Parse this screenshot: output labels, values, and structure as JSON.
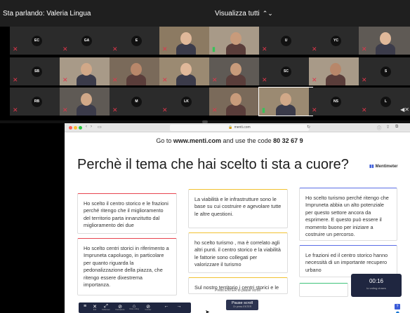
{
  "conference": {
    "speaking_label": "Sta parlando: Valeria Lingua",
    "view_all_label": "Visualizza tutti"
  },
  "participants": [
    {
      "initials": "EC",
      "mic": "muted"
    },
    {
      "initials": "GA",
      "mic": "muted"
    },
    {
      "initials": "E",
      "mic": "muted"
    },
    {
      "initials": "",
      "mic": "muted",
      "video": true
    },
    {
      "initials": "",
      "mic": "on",
      "video": true
    },
    {
      "initials": "U",
      "mic": "muted"
    },
    {
      "initials": "YC",
      "mic": "muted"
    },
    {
      "initials": "",
      "mic": "muted",
      "video": true
    },
    {
      "initials": "SB",
      "mic": "muted"
    },
    {
      "initials": "",
      "mic": "muted",
      "video": true
    },
    {
      "initials": "",
      "mic": "muted",
      "video": true
    },
    {
      "initials": "",
      "mic": "muted",
      "video": true
    },
    {
      "initials": "",
      "mic": "muted",
      "video": true
    },
    {
      "initials": "SC",
      "mic": "muted"
    },
    {
      "initials": "",
      "mic": "muted",
      "video": true
    },
    {
      "initials": "S",
      "mic": "muted"
    },
    {
      "initials": "RB",
      "mic": "muted"
    },
    {
      "initials": "",
      "mic": "muted",
      "video": true
    },
    {
      "initials": "M",
      "mic": "muted"
    },
    {
      "initials": "LK",
      "mic": "muted"
    },
    {
      "initials": "",
      "mic": "muted",
      "video": true
    },
    {
      "initials": "",
      "mic": "on",
      "video": true
    },
    {
      "initials": "NS",
      "mic": "muted"
    },
    {
      "initials": "L",
      "mic": "muted"
    }
  ],
  "browser": {
    "url": "menti.com"
  },
  "menti": {
    "join_prefix": "Go to ",
    "join_site": "www.menti.com",
    "join_middle": " and use the code ",
    "join_code": "80 32 67 9",
    "question": "Perchè il tema che hai scelto ti sta a cuore?",
    "brand": "Mentimeter",
    "cards": [
      "Ho scelto il centro storico e le frazioni perché ritengo che il miglioramento del territorio parta innanzitutto dal miglioramento dei due",
      "La viabilità e le infrastrutture sono le base su cui costruire e agevolare tutte le altre questioni.",
      "Ho scelto turismo perché ritengo che Impruneta abbia un alto potenziale per questo settore ancora da esprimere. E questo può essere il momento buono per iniziare a costruire un percorso.",
      "Ho scelto centri storici in riferimento a Impruneta capoluogo, in particolare per quanto riguarda la pedonalizzazione della piazza, che ritengo essere dixestrema importanza.",
      "ho scelto turismo , ma è correlato agli altri punti. il centro storico e la viabilità le fattorie sono collegati per valorizzare il turismo",
      "Le frazioni ed il centro storico hanno necessità di un importante recupero urbano",
      "Sul nostro territorio i centri storici e le"
    ],
    "timer": {
      "time": "00:16",
      "label": "to voting closes"
    },
    "enter_hint": "Press ENTER to pause scroll",
    "pause_button": {
      "label": "Pause scroll",
      "sub": "Or press ENTER"
    },
    "toolbar_items": [
      "Exit",
      "Fullscreen",
      "Participants",
      "Close voting",
      "Counter",
      "",
      ""
    ]
  },
  "colors": {
    "mute_red": "#e0364b",
    "mic_green": "#38c35a",
    "card_red": "#e8434f",
    "card_yellow": "#f2c230",
    "card_blue": "#5a6de6",
    "card_green": "#3ec37a",
    "timer_bg": "#1f2640"
  }
}
